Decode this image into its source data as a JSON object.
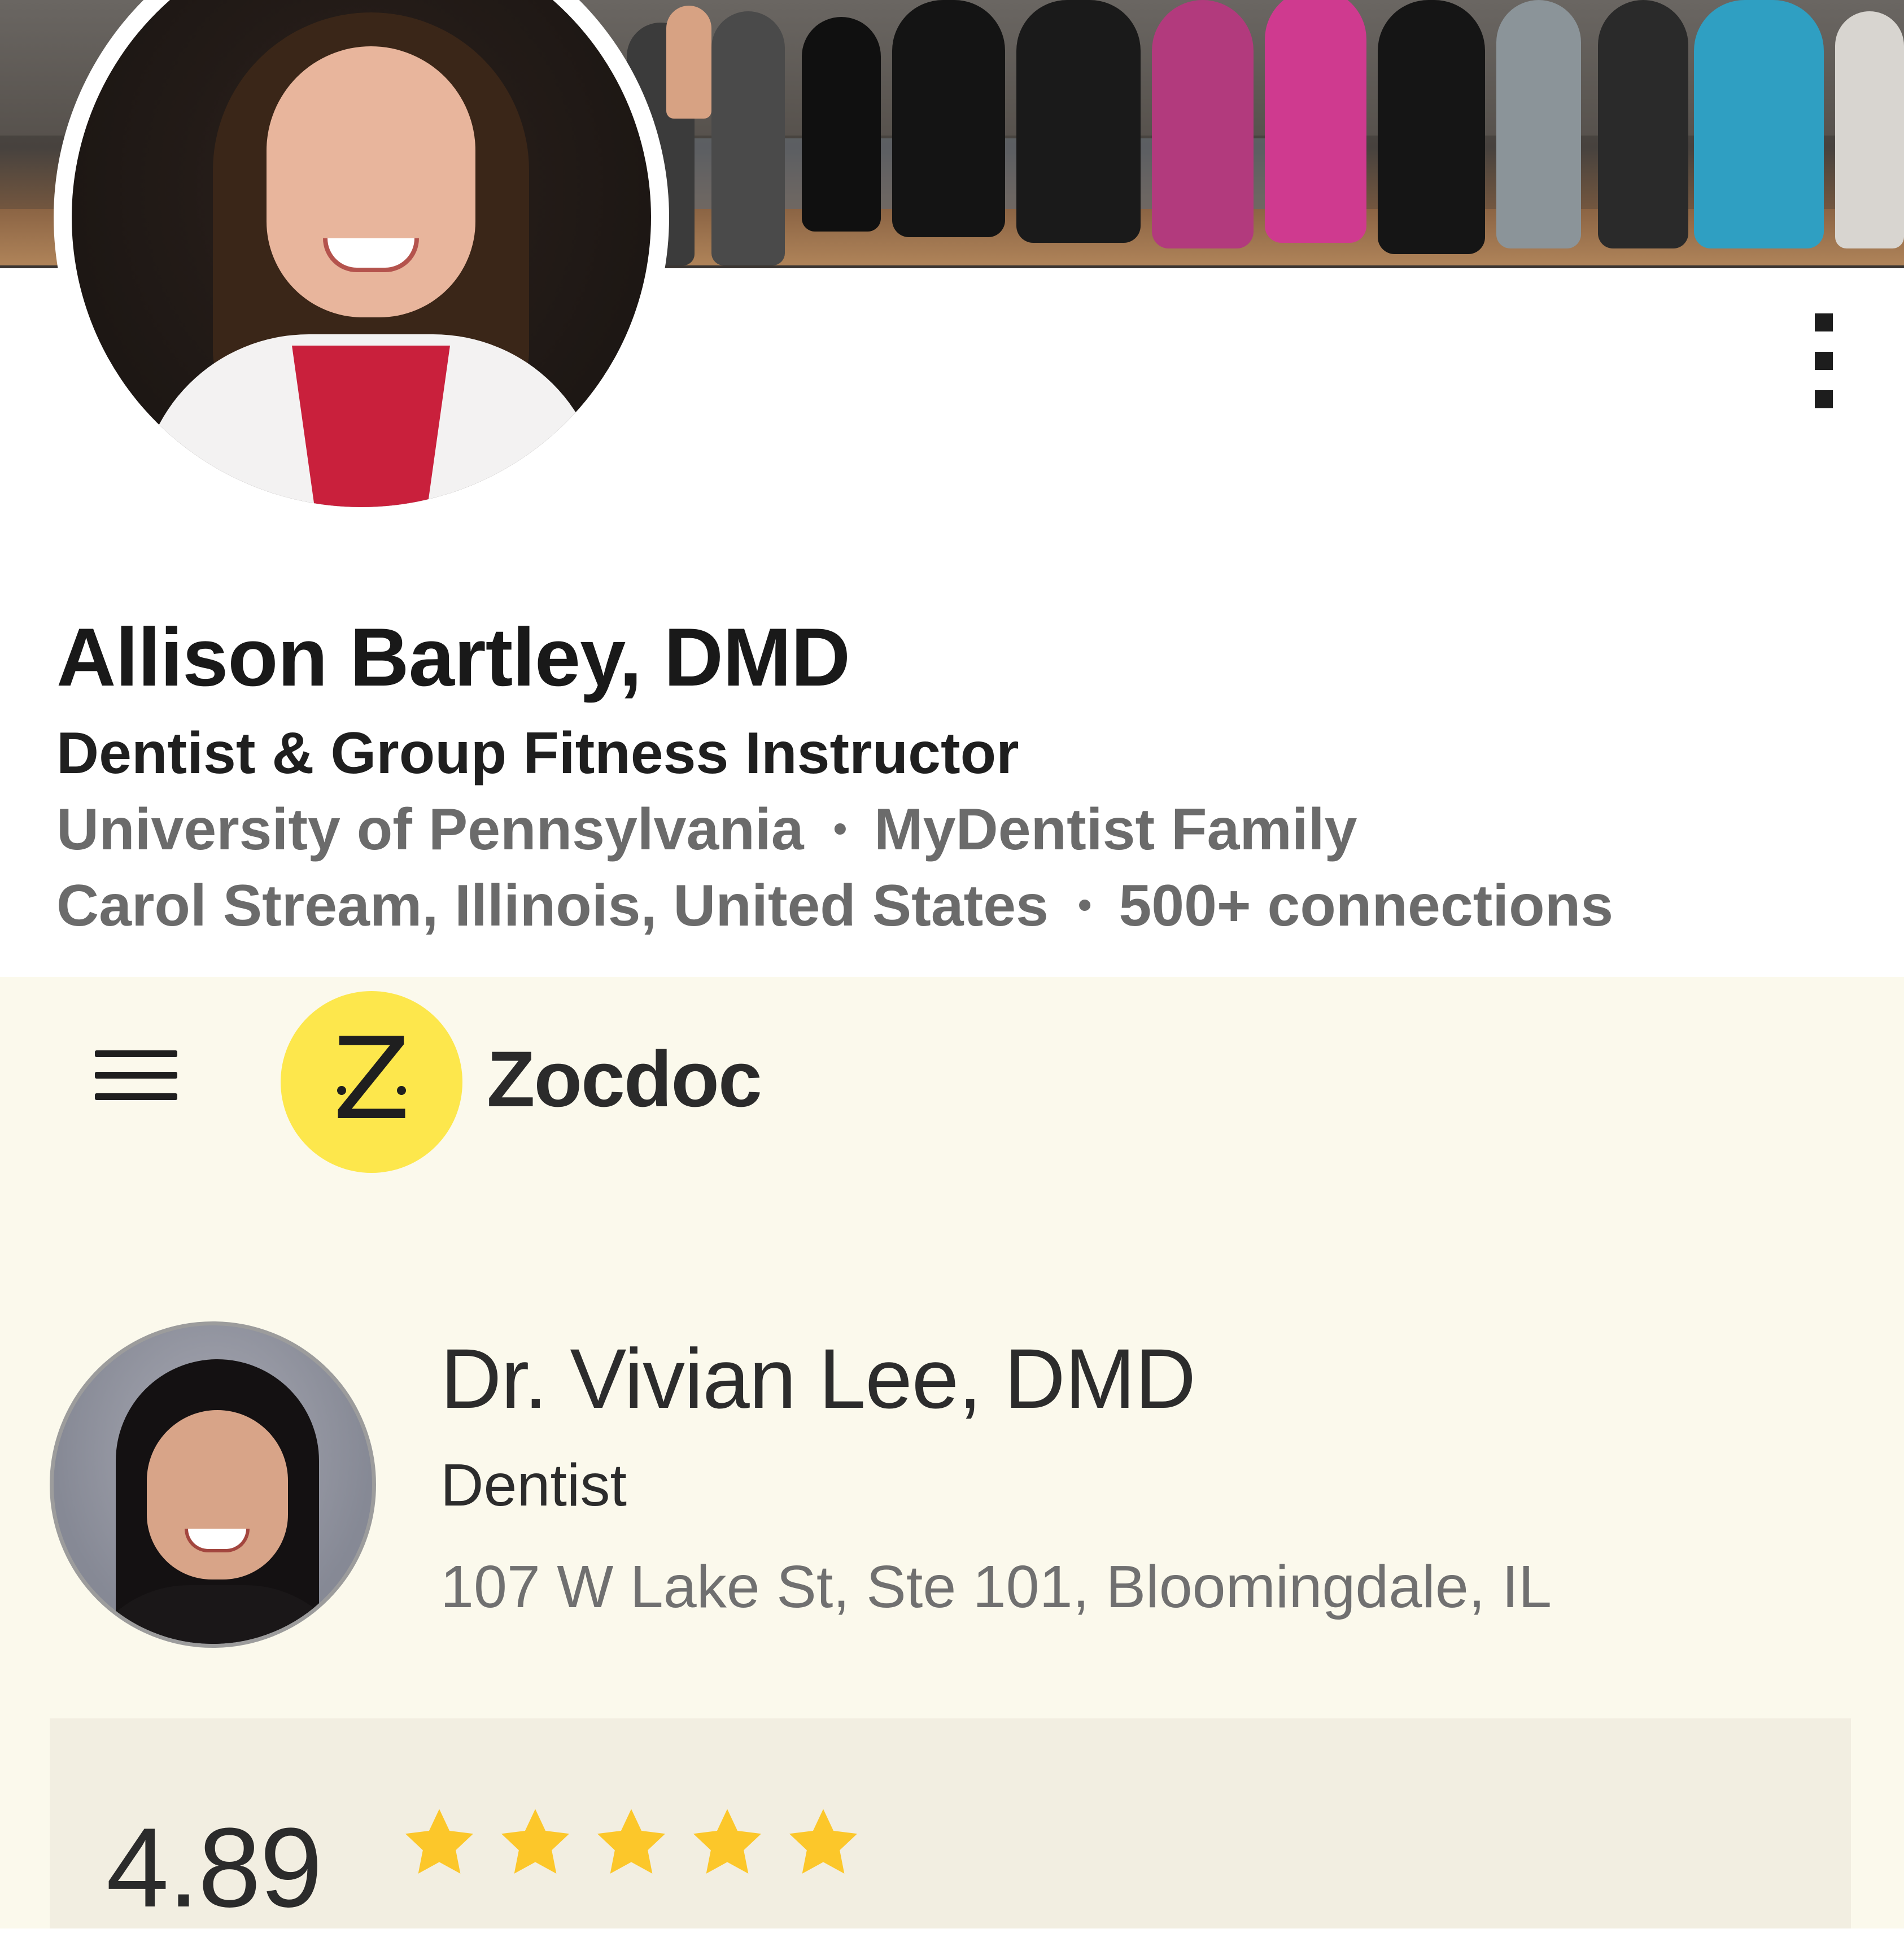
{
  "linkedin": {
    "cover_image": "group-fitness-class-photo",
    "avatar_image": "profile-photo",
    "more_icon": "vertical-ellipsis-icon",
    "name": "Allison Bartley, DMD",
    "headline": "Dentist & Group Fitness Instructor",
    "education": "University of Pennsylvania",
    "company": "MyDentist Family",
    "location": "Carol Stream, Illinois, United States",
    "connections": "500+ connections",
    "separator": "•"
  },
  "zocdoc": {
    "menu_icon": "hamburger-menu-icon",
    "logo_letter": "Z",
    "brand": "Zocdoc",
    "doctor": {
      "name": "Dr. Vivian Lee, DMD",
      "specialty": "Dentist",
      "address": "107 W Lake St, Ste 101, Bloomingdale, IL"
    },
    "rating": {
      "value": "4.89",
      "stars": 5,
      "star_color": "#fcc72a"
    }
  },
  "colors": {
    "zocdoc_background": "#fbf9ec",
    "zocdoc_yellow": "#fde74c",
    "rating_card": "#f2eee1"
  }
}
